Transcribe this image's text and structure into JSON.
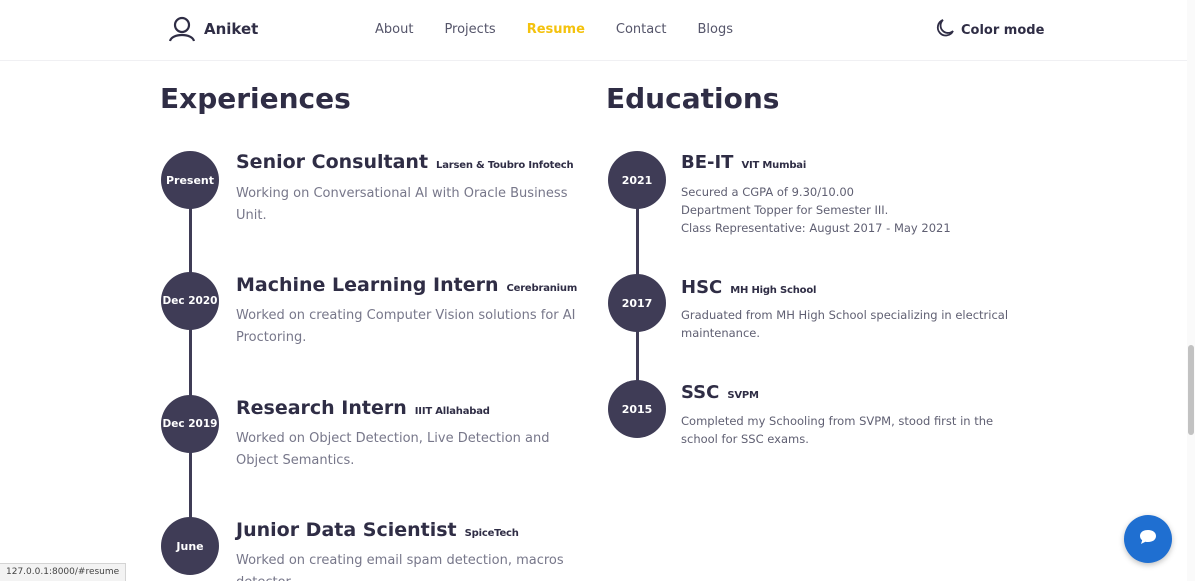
{
  "nav": {
    "brand": "Aniket",
    "links": [
      {
        "label": "About",
        "active": false
      },
      {
        "label": "Projects",
        "active": false
      },
      {
        "label": "Resume",
        "active": true
      },
      {
        "label": "Contact",
        "active": false
      },
      {
        "label": "Blogs",
        "active": false
      }
    ],
    "color_mode": "Color mode",
    "accent_color": "#f4c20d"
  },
  "experiences": {
    "title": "Experiences",
    "items": [
      {
        "date": "Present",
        "role": "Senior Consultant",
        "org": "Larsen & Toubro Infotech",
        "desc": "Working on Conversational AI with Oracle Business Unit."
      },
      {
        "date": "Dec 2020",
        "role": "Machine Learning Intern",
        "org": "Cerebranium",
        "desc": "Worked on creating Computer Vision solutions for AI Proctoring."
      },
      {
        "date": "Dec 2019",
        "role": "Research Intern",
        "org": "IIIT Allahabad",
        "desc": "Worked on Object Detection, Live Detection and Object Semantics."
      },
      {
        "date": "June",
        "role": "Junior Data Scientist",
        "org": "SpiceTech",
        "desc": "Worked on creating email spam detection, macros detector"
      }
    ]
  },
  "educations": {
    "title": "Educations",
    "items": [
      {
        "date": "2021",
        "role": "BE-IT",
        "org": "VIT Mumbai",
        "lines": [
          "Secured a CGPA of 9.30/10.00",
          "Department Topper for Semester III.",
          "Class Representative: August 2017 - May 2021"
        ]
      },
      {
        "date": "2017",
        "role": "HSC",
        "org": "MH High School",
        "lines": [
          "Graduated from MH High School specializing in electrical maintenance."
        ]
      },
      {
        "date": "2015",
        "role": "SSC",
        "org": "SVPM",
        "lines": [
          "Completed my Schooling from SVPM, stood first in the school for SSC exams."
        ]
      }
    ]
  },
  "statusbar": {
    "url": "127.0.0.1:8000/#resume"
  },
  "icons": {
    "brand": "user-icon",
    "color_mode": "moon-icon",
    "chat": "chat-icon"
  },
  "colors": {
    "timeline": "#3f3c56",
    "chat_button": "#1f6fd1"
  }
}
